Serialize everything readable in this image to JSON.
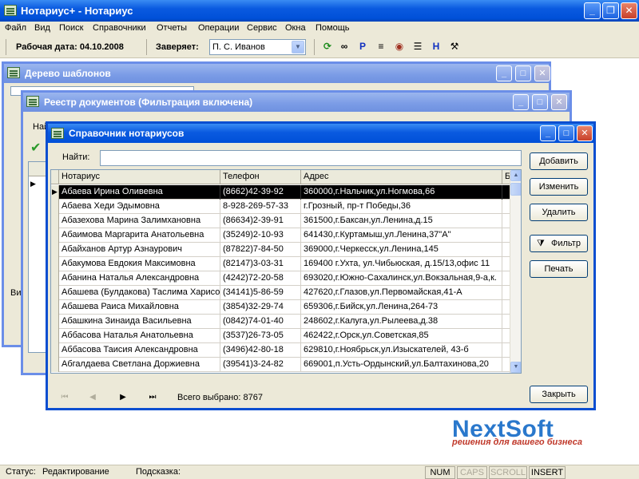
{
  "window": {
    "title": "Нотариус+ - Нотариус"
  },
  "menu": [
    "Файл",
    "Вид",
    "Поиск",
    "Справочники",
    "Отчеты",
    "Операции",
    "Сервис",
    "Окна",
    "Помощь"
  ],
  "toolbar": {
    "work_date": "Рабочая дата: 04.10.2008",
    "certifier_label": "Заверяет:",
    "certifier_value": "П. С. Иванов",
    "icons": [
      "refresh-icon",
      "binoculars-icon",
      "p-icon",
      "tree-icon",
      "search-db-icon",
      "list-icon",
      "h-icon",
      "tools-icon"
    ]
  },
  "windows": {
    "templates_title": "Дерево шаблонов",
    "registry_title": "Реестр документов (Фильтрация включена)",
    "registry_partial_label": "Най",
    "templates_partial_label": "Ви"
  },
  "dialog": {
    "title": "Справочник нотариусов",
    "search_label": "Найти:",
    "search_value": "",
    "buttons": {
      "add": "Добавить",
      "edit": "Изменить",
      "delete": "Удалить",
      "filter": "Фильтр",
      "print": "Печать",
      "close": "Закрыть"
    },
    "columns": [
      "Нотариус",
      "Телефон",
      "Адрес",
      "Б"
    ],
    "rows": [
      [
        "Абаева Ирина Оливевна",
        "(8662)42-39-92",
        "360000,г.Нальчик,ул.Ногмова,66"
      ],
      [
        "Абаева Хеди Эдымовна",
        "8-928-269-57-33",
        "г.Грозный, пр-т Победы,36"
      ],
      [
        "Абазехова Марина Залимхановна",
        "(86634)2-39-91",
        "361500,г.Баксан,ул.Ленина,д.15"
      ],
      [
        "Абаимова Маргарита Анатольевна",
        "(35249)2-10-93",
        "641430,г.Куртамыш,ул.Ленина,37\"А\""
      ],
      [
        "Абайханов Артур Азнаурович",
        "(87822)7-84-50",
        "369000,г.Черкесск,ул.Ленина,145"
      ],
      [
        "Абакумова Евдокия Максимовна",
        "(82147)3-03-31",
        "169400 г.Ухта, ул.Чибьюская, д.15/13,офис 11"
      ],
      [
        "Абанина Наталья Александровна",
        "(4242)72-20-58",
        "693020,г.Южно-Сахалинск,ул.Вокзальная,9-а,к."
      ],
      [
        "Абашева (Булдакова) Таслима Харисов",
        "(34141)5-86-59",
        "427620,г.Глазов,ул.Первомайская,41-А"
      ],
      [
        "Абашева Раиса Михайловна",
        "(3854)32-29-74",
        "659306,г.Бийск,ул.Ленина,264-73"
      ],
      [
        "Абашкина Зинаида Васильевна",
        "(0842)74-01-40",
        "248602,г.Калуга,ул.Рылеева,д.38"
      ],
      [
        "Аббасова Наталья Анатольевна",
        "(3537)26-73-05",
        "462422,г.Орск,ул.Советская,85"
      ],
      [
        "Аббасова Таисия Александровна",
        "(3496)42-80-18",
        "629810,г.Ноябрьск,ул.Изыскателей, 43-б"
      ],
      [
        "Абгалдаева Светлана Доржиевна",
        "(39541)3-24-82",
        "669001,п.Усть-Ордынский,ул.Балтахинова,20"
      ]
    ],
    "total_selected": "Всего выбрано: 8767"
  },
  "status": {
    "status_label": "Статус:",
    "status_value": "Редактирование",
    "hint_label": "Подсказка:",
    "panels": [
      "NUM",
      "CAPS",
      "SCROLL",
      "INSERT"
    ]
  },
  "logo": {
    "name": "NextSoft",
    "tagline": "решения для вашего бизнеса"
  },
  "colors": {
    "title_blue": "#0a5ae0",
    "logo_blue": "#2a78cc",
    "logo_red": "#c0392b",
    "selection": "#000000"
  }
}
